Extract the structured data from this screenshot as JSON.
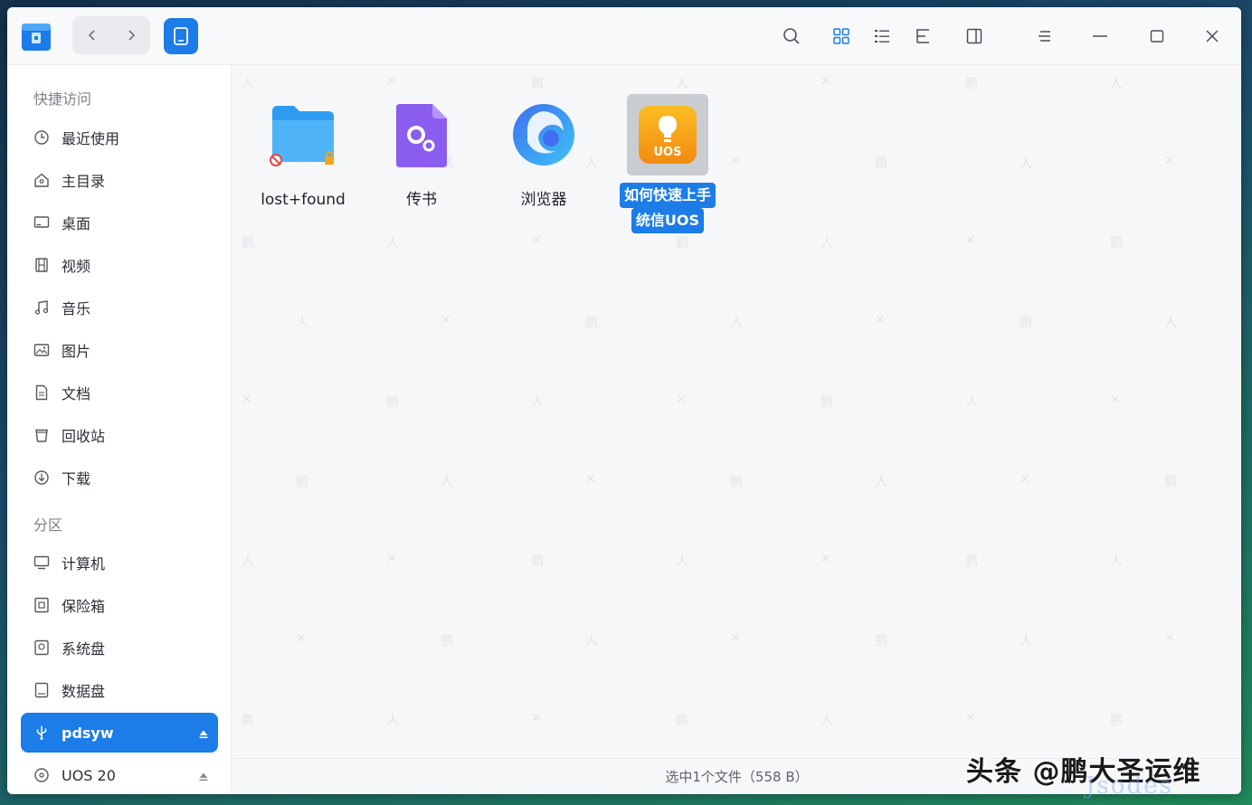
{
  "sidebar": {
    "section_quick": "快捷访问",
    "quick_items": [
      {
        "label": "最近使用",
        "icon": "clock-icon"
      },
      {
        "label": "主目录",
        "icon": "home-icon"
      },
      {
        "label": "桌面",
        "icon": "desktop-icon"
      },
      {
        "label": "视频",
        "icon": "film-icon"
      },
      {
        "label": "音乐",
        "icon": "music-note-icon"
      },
      {
        "label": "图片",
        "icon": "picture-icon"
      },
      {
        "label": "文档",
        "icon": "document-icon"
      },
      {
        "label": "回收站",
        "icon": "trash-icon"
      },
      {
        "label": "下载",
        "icon": "download-icon"
      }
    ],
    "section_partition": "分区",
    "partition_items": [
      {
        "label": "计算机",
        "icon": "computer-icon"
      },
      {
        "label": "保险箱",
        "icon": "safe-icon"
      },
      {
        "label": "系统盘",
        "icon": "disk-icon"
      },
      {
        "label": "数据盘",
        "icon": "disk-icon"
      },
      {
        "label": "pdsyw",
        "icon": "usb-icon",
        "active": true
      },
      {
        "label": "UOS 20",
        "icon": "optical-disc-icon"
      }
    ]
  },
  "files": [
    {
      "name": "lost+found",
      "icon": "folder-locked-icon"
    },
    {
      "name": "传书",
      "icon": "settings-file-icon"
    },
    {
      "name": "浏览器",
      "icon": "browser-icon"
    },
    {
      "name_line1": "如何快速上手",
      "name_line2": "统信UOS",
      "icon": "uos-guide-icon",
      "icon_text": "UOS",
      "selected": true
    }
  ],
  "status": {
    "text": "选中1个文件（558 B）"
  },
  "overlay": {
    "watermark": "头条 @鹏大圣运维",
    "faint_text": "Jsodes"
  },
  "colors": {
    "accent": "#1c7ce8",
    "folder": "#2e9cf0",
    "settings_file": "#8a5cf0",
    "uos_orange": "#f7a11a"
  }
}
